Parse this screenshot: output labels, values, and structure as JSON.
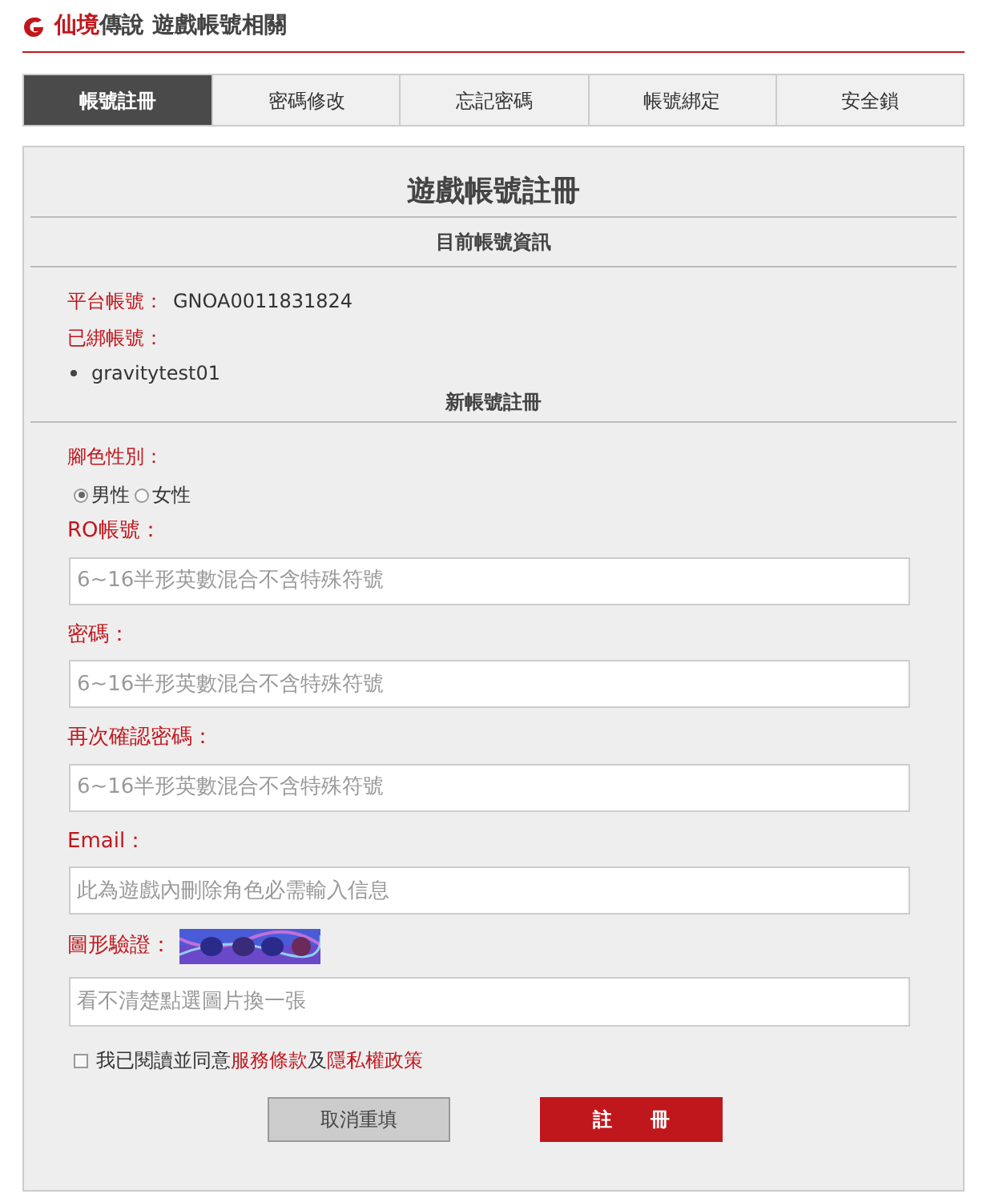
{
  "header": {
    "title_brand": "仙境",
    "title_rest": "傳說 遊戲帳號相關"
  },
  "tabs": [
    {
      "label": "帳號註冊",
      "selected": true
    },
    {
      "label": "密碼修改",
      "selected": false
    },
    {
      "label": "忘記密碼",
      "selected": false
    },
    {
      "label": "帳號綁定",
      "selected": false
    },
    {
      "label": "安全鎖",
      "selected": false
    }
  ],
  "form": {
    "title": "遊戲帳號註冊",
    "account_section": {
      "heading": "目前帳號資訊",
      "platform_label": "平台帳號：",
      "platform_value": "GNOA0011831824",
      "bound_label": "已綁帳號：",
      "bound_accounts": [
        "gravitytest01"
      ]
    },
    "new_section": {
      "heading": "新帳號註冊",
      "gender_label": "腳色性別：",
      "genders": [
        {
          "label": "男性",
          "selected": true
        },
        {
          "label": "女性",
          "selected": false
        }
      ],
      "fields": [
        {
          "label": "RO帳號：",
          "placeholder": "6~16半形英數混合不含特殊符號"
        },
        {
          "label": "密碼：",
          "placeholder": "6~16半形英數混合不含特殊符號"
        },
        {
          "label": "再次確認密碼：",
          "placeholder": "6~16半形英數混合不含特殊符號"
        },
        {
          "label": "Email：",
          "placeholder": "此為遊戲內刪除角色必需輸入信息"
        }
      ],
      "captcha_label": "圖形驗證：",
      "captcha_placeholder": "看不清楚點選圖片換一張"
    },
    "agree": {
      "checked": false,
      "prefix": "我已閱讀並同意",
      "terms_link": "服務條款",
      "joiner": "及",
      "privacy_link": "隱私權政策"
    },
    "buttons": {
      "reset": "取消重填",
      "submit": "註　　冊"
    }
  }
}
